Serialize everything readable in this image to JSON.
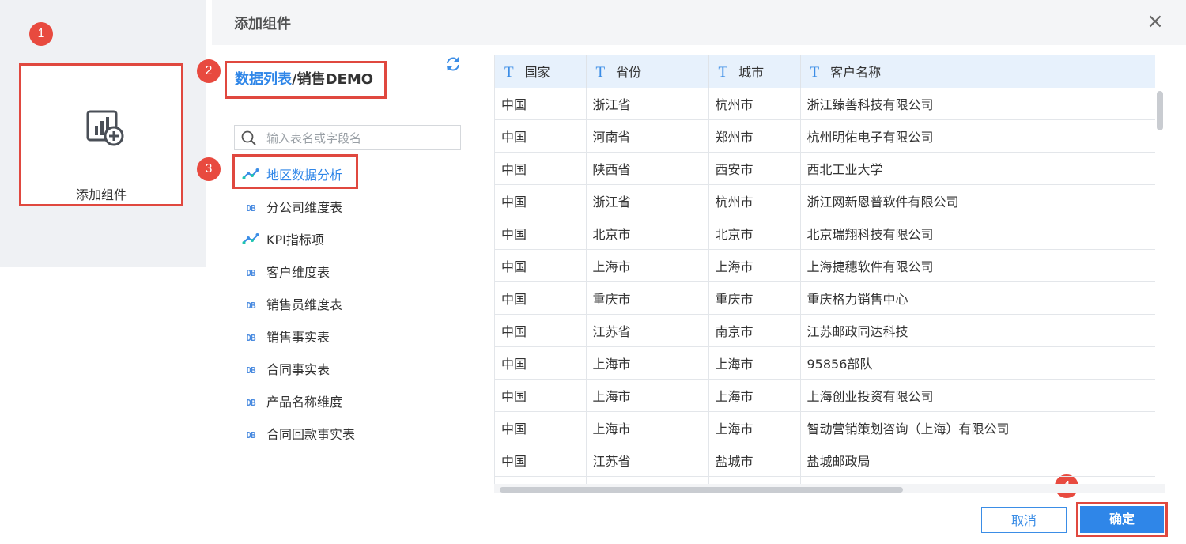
{
  "left_card": {
    "label": "添加组件"
  },
  "badges": [
    "1",
    "2",
    "3",
    "4"
  ],
  "dialog": {
    "title": "添加组件",
    "close_glyph": "×",
    "breadcrumb": {
      "link": "数据列表",
      "sep": "/",
      "current": "销售DEMO"
    },
    "search": {
      "placeholder": "输入表名或字段名",
      "value": ""
    },
    "tree": [
      {
        "label": "地区数据分析",
        "icon": "dataset-icon",
        "active": true
      },
      {
        "label": "分公司维度表",
        "icon": "db-icon"
      },
      {
        "label": "KPI指标项",
        "icon": "dataset-icon"
      },
      {
        "label": "客户维度表",
        "icon": "db-icon"
      },
      {
        "label": "销售员维度表",
        "icon": "db-icon"
      },
      {
        "label": "销售事实表",
        "icon": "db-icon"
      },
      {
        "label": "合同事实表",
        "icon": "db-icon"
      },
      {
        "label": "产品名称维度",
        "icon": "db-icon"
      },
      {
        "label": "合同回款事实表",
        "icon": "db-icon"
      }
    ],
    "db_glyph": "DB",
    "table": {
      "type_glyph": "T",
      "columns": [
        "国家",
        "省份",
        "城市",
        "客户名称"
      ],
      "rows": [
        [
          "中国",
          "浙江省",
          "杭州市",
          "浙江臻善科技有限公司"
        ],
        [
          "中国",
          "河南省",
          "郑州市",
          "杭州明佑电子有限公司"
        ],
        [
          "中国",
          "陕西省",
          "西安市",
          "西北工业大学"
        ],
        [
          "中国",
          "浙江省",
          "杭州市",
          "浙江网新恩普软件有限公司"
        ],
        [
          "中国",
          "北京市",
          "北京市",
          "北京瑞翔科技有限公司"
        ],
        [
          "中国",
          "上海市",
          "上海市",
          "上海捷穗软件有限公司"
        ],
        [
          "中国",
          "重庆市",
          "重庆市",
          "重庆格力销售中心"
        ],
        [
          "中国",
          "江苏省",
          "南京市",
          "江苏邮政同达科技"
        ],
        [
          "中国",
          "上海市",
          "上海市",
          "95856部队"
        ],
        [
          "中国",
          "上海市",
          "上海市",
          "上海创业投资有限公司"
        ],
        [
          "中国",
          "上海市",
          "上海市",
          "智动营销策划咨询（上海）有限公司"
        ],
        [
          "中国",
          "江苏省",
          "盐城市",
          "盐城邮政局"
        ],
        [
          "",
          "",
          "",
          ""
        ]
      ]
    },
    "buttons": {
      "cancel": "取消",
      "ok": "确定"
    }
  },
  "colors": {
    "accent": "#2f86e8",
    "highlight": "#e0483f",
    "header_bg": "#e7f1fc"
  }
}
